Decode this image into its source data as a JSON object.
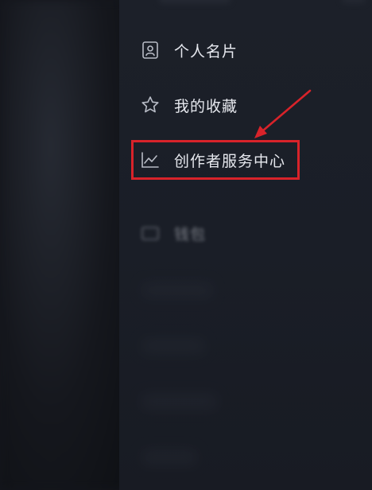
{
  "menu": {
    "items": [
      {
        "label": "个人名片",
        "icon": "id-card-icon"
      },
      {
        "label": "我的收藏",
        "icon": "star-icon"
      },
      {
        "label": "创作者服务中心",
        "icon": "chart-icon",
        "highlighted": true
      },
      {
        "label": "钱包",
        "icon": "wallet-icon",
        "blurred": true
      }
    ]
  },
  "colors": {
    "background": "#14161c",
    "drawer": "#1c2029",
    "text": "#e6e8ee",
    "highlight": "#d8232a"
  }
}
